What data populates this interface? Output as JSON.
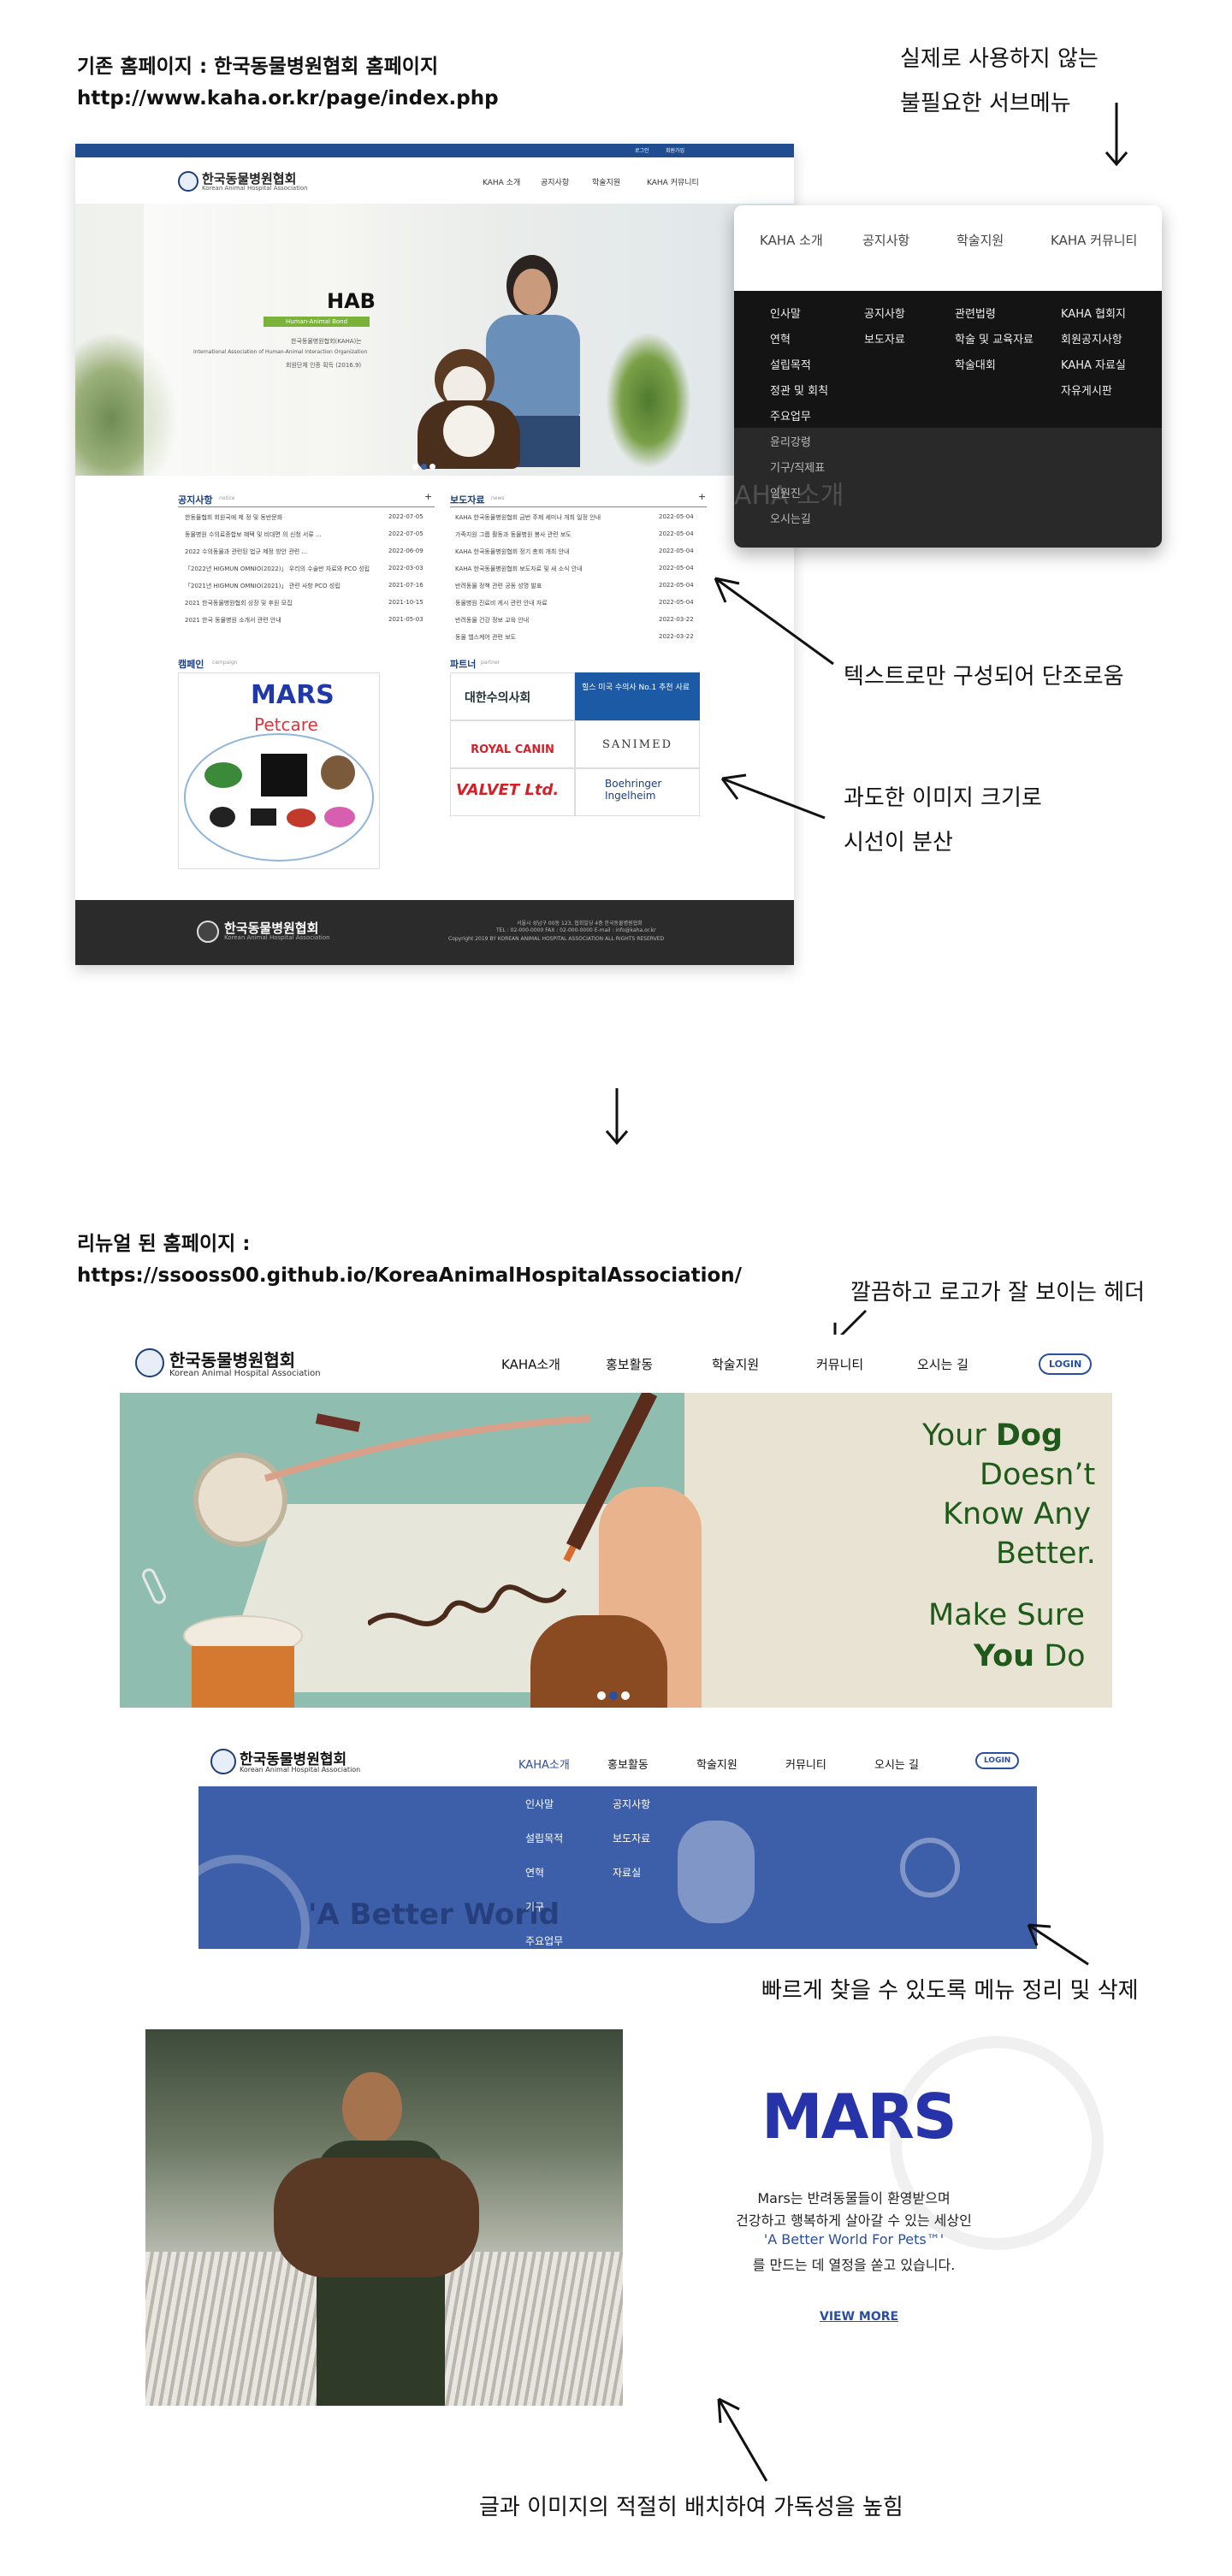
{
  "top_section": {
    "title": "기존 홈페이지 : 한국동물병원협회 홈페이지",
    "url": "http://www.kaha.or.kr/page/index.php"
  },
  "annotations": {
    "unused_submenu_line1": "실제로 사용하지 않는",
    "unused_submenu_line2": "불필요한 서브메뉴",
    "text_only": "텍스트로만 구성되어 단조로움",
    "image_size_line1": "과도한 이미지 크기로",
    "image_size_line2": "시선이 분산",
    "clean_header": "깔끔하고 로고가 잘 보이는 헤더",
    "menu_cleanup": "빠르게 찾을 수 있도록 메뉴 정리 및 삭제",
    "readability": "글과 이미지의 적절히 배치하여 가독성을 높힘"
  },
  "old_site": {
    "topbar_links": [
      "로그인",
      "회원가입"
    ],
    "logo_ko": "한국동물병원협회",
    "logo_en": "Korean Animal Hospital Association",
    "nav": [
      "KAHA 소개",
      "공지사항",
      "학술지원",
      "KAHA 커뮤니티"
    ],
    "hero_title": "HAB",
    "hero_badge": "Human-Animal Bond",
    "hero_text1": "한국동물병원협회(KAHA)는",
    "hero_text2": "International Association of Human-Animal Interaction Organization",
    "hero_text3": "회원단체 인증 획득 (2016.9)",
    "notice_title": "공지사항",
    "notice_sub": "notice",
    "notice_items": [
      {
        "t": "한동물협회 회원국에 제 정 및 동반문화",
        "d": "2022-07-05"
      },
      {
        "t": "동물병원 수의료종합보 혜택 및 비대면 의 신청 서류 ...",
        "d": "2022-07-05"
      },
      {
        "t": "2022 수의동물과 관련된 법규 제정 방안 관련 ...",
        "d": "2022-06-09"
      },
      {
        "t": "「2022년 HIGMUN OMNIO(2022)」 우리의 수술반 자료와 PCO 성립",
        "d": "2022-03-03"
      },
      {
        "t": "「2021년 HIGMUN OMNIO(2021)」 관련 사항 PCO 성립",
        "d": "2021-07-16"
      },
      {
        "t": "2021 한국동물병원협회 상장 및 후원 모집",
        "d": "2021-10-15"
      },
      {
        "t": "2021 한국 동물병원 소개서 관련 안내",
        "d": "2021-05-03"
      }
    ],
    "press_title": "보도자료",
    "press_sub": "news",
    "press_items": [
      {
        "t": "KAHA 한국동물병원협회 금번 주제 세미나 개최 일정 안내",
        "d": "2022-05-04"
      },
      {
        "t": "가족지원 그룹 활동과 동물병원 봉사 관련 보도",
        "d": "2022-05-04"
      },
      {
        "t": "KAHA 한국동물병원협회 정기 총회 개최 안내",
        "d": "2022-05-04"
      },
      {
        "t": "KAHA 한국동물병원협회 보도자료 및 새 소식 안내",
        "d": "2022-05-04"
      },
      {
        "t": "반려동물 정책 관련 공동 성명 발표",
        "d": "2022-05-04"
      },
      {
        "t": "동물병원 진료비 게시 관련 안내 자료",
        "d": "2022-05-04"
      },
      {
        "t": "반려동물 건강 정보 교육 안내",
        "d": "2022-03-22"
      },
      {
        "t": "동물 헬스케어 관련 보도",
        "d": "2022-03-22"
      }
    ],
    "campaign_title": "캠페인",
    "campaign_sub": "campaign",
    "campaign_brand": "MARS",
    "campaign_brand2": "Petcare",
    "partner_title": "파트너",
    "partner_sub": "partner",
    "partners": [
      "대한수의사회",
      "힐스 미국 수의사 No.1 추천 사료",
      "ROYAL CANIN",
      "SANIMED",
      "VALVET Ltd.",
      "Boehringer Ingelheim"
    ],
    "footer_logo": "한국동물병원협회",
    "footer_logo_en": "Korean Animal Hospital Association",
    "footer_addr": "서울시 성남구 00동 123, 협회빌딩 4층 한국동물병원협회",
    "footer_tel": "TEL : 02-000-0000   FAX : 02-000-0000   E-mail : info@kaha.or.kr",
    "footer_copy": "Copyright 2019 BY KOREAN ANIMAL HOSPITAL ASSOCIATION ALL RIGHTS RESERVED"
  },
  "submenu_panel": {
    "tabs": [
      "KAHA 소개",
      "공지사항",
      "학술지원",
      "KAHA 커뮤니티"
    ],
    "col1": [
      "인사말",
      "연혁",
      "설립목적",
      "정관 및 회칙",
      "주요업무",
      "윤리강령",
      "기구/직제표",
      "임원진",
      "오시는길"
    ],
    "col2": [
      "공지사항",
      "보도자료"
    ],
    "col3": [
      "관련법령",
      "학술 및 교육자료",
      "학술대회"
    ],
    "col4": [
      "KAHA 협회지",
      "회원공지사항",
      "KAHA 자료실",
      "자유게시판"
    ],
    "ghost": "AHA 소개"
  },
  "middle_arrow": "↓",
  "bottom_section": {
    "title": "리뉴얼 된 홈페이지 :",
    "url": "https://ssooss00.github.io/KoreaAnimalHospitalAssociation/"
  },
  "new_site": {
    "logo_ko": "한국동물병원협회",
    "logo_en": "Korean Animal Hospital Association",
    "nav": [
      "KAHA소개",
      "홍보활동",
      "학술지원",
      "커뮤니티",
      "오시는 길"
    ],
    "login": "LOGIN",
    "banner_line1a": "Your ",
    "banner_line1b": "Dog",
    "banner_line2": "Doesn’t",
    "banner_line3": "Know Any",
    "banner_line4": "Better.",
    "banner_line5": "Make Sure",
    "banner_line6a": "You",
    "banner_line6b": " Do",
    "dropdown_col1": [
      "인사말",
      "설립목적",
      "연혁",
      "기구",
      "주요업무"
    ],
    "dropdown_col2": [
      "공지사항",
      "보도자료",
      "자료실"
    ],
    "dropdown_bg_text": "'A Better World",
    "mars_logo": "MARS",
    "mars_line1": "Mars는 반려동물들이 환영받으며",
    "mars_line2": "건강하고 행복하게 살아갈 수 있는 세상인",
    "mars_slogan": "'A Better World For Pets™'",
    "mars_line3": "를 만드는 데 열정을 쏟고 있습니다.",
    "view_more": "VIEW MORE"
  },
  "colors": {
    "brand_blue": "#2a4ea0",
    "banner_green": "#1f5a1a",
    "dark_footer": "#2b2b2b",
    "dropdown_blue": "#3d5ea8"
  }
}
